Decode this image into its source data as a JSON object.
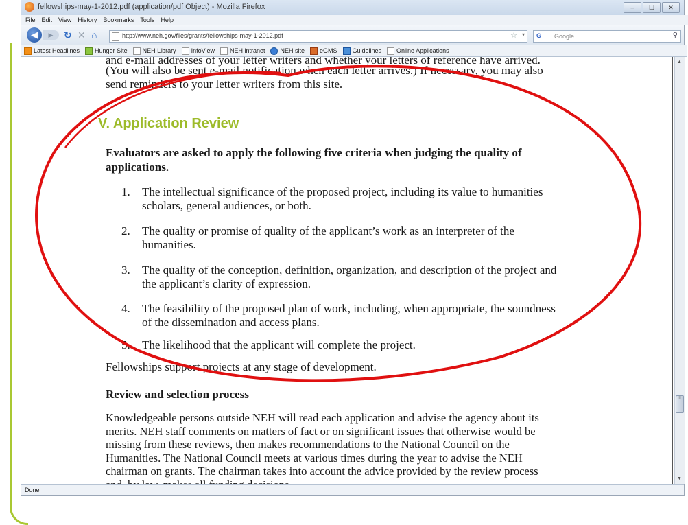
{
  "window": {
    "title": "fellowships-may-1-2012.pdf (application/pdf Object) - Mozilla Firefox",
    "controls": [
      "–",
      "☐",
      "✕"
    ]
  },
  "menu": [
    "File",
    "Edit",
    "View",
    "History",
    "Bookmarks",
    "Tools",
    "Help"
  ],
  "nav": {
    "url": "http://www.neh.gov/files/grants/fellowships-may-1-2012.pdf",
    "search_placeholder": "Google",
    "search_engine_label": "G"
  },
  "bookmarks": [
    {
      "label": "Latest Headlines",
      "icon": "rss-icon"
    },
    {
      "label": "Hunger Site",
      "icon": "leaf-icon"
    },
    {
      "label": "NEH Library",
      "icon": "page-icon"
    },
    {
      "label": "InfoView",
      "icon": "page-icon"
    },
    {
      "label": "NEH intranet",
      "icon": "page-icon"
    },
    {
      "label": "NEH site",
      "icon": "ie-icon"
    },
    {
      "label": "eGMS",
      "icon": "egms-icon"
    },
    {
      "label": "Guidelines",
      "icon": "guidelines-icon"
    },
    {
      "label": "Online Applications",
      "icon": "page-icon"
    }
  ],
  "document": {
    "cut_line": "and e-mail addresses of your letter writers and whether your letters of reference have arrived.",
    "paragraph_lines": [
      "(You will also be sent e-mail notification when each letter arrives.) If necessary, you may also",
      "send reminders to your letter writers from this site."
    ],
    "section_heading": "V. Application Review",
    "intro_lines": [
      "Evaluators are asked to apply the following five criteria when judging the quality of",
      "applications."
    ],
    "criteria": [
      {
        "num": "1.",
        "lines": [
          "The intellectual significance of the proposed project, including its value to humanities",
          "scholars, general audiences, or both."
        ]
      },
      {
        "num": "2.",
        "lines": [
          "The quality or promise of quality of the applicant’s work as an interpreter of the",
          "humanities."
        ]
      },
      {
        "num": "3.",
        "lines": [
          "The quality of the conception, definition, organization, and description of the project and",
          "the applicant’s clarity of expression."
        ]
      },
      {
        "num": "4.",
        "lines": [
          "The feasibility of the proposed plan of work, including, when appropriate, the soundness",
          "of the dissemination and access plans."
        ]
      },
      {
        "num": "5.",
        "lines": [
          "The likelihood that the applicant will complete the project."
        ]
      }
    ],
    "support_text": "Fellowships support projects at any stage of development.",
    "subheading": "Review and selection process",
    "review_lines": [
      "Knowledgeable persons outside NEH will read each application and advise the agency about its",
      "merits. NEH staff comments on matters of fact or on significant issues that otherwise would be",
      "missing from these reviews, then makes recommendations to the National Council on the",
      "Humanities. The National Council meets at various times during the year to advise the NEH",
      "chairman on grants. The chairman takes into account the advice provided by the review process",
      "and, by law, makes all funding decisions."
    ]
  },
  "status": "Done",
  "colors": {
    "heading_green": "#9dbb2a",
    "annotation_red": "#e01010",
    "slide_accent": "#a9c832"
  }
}
